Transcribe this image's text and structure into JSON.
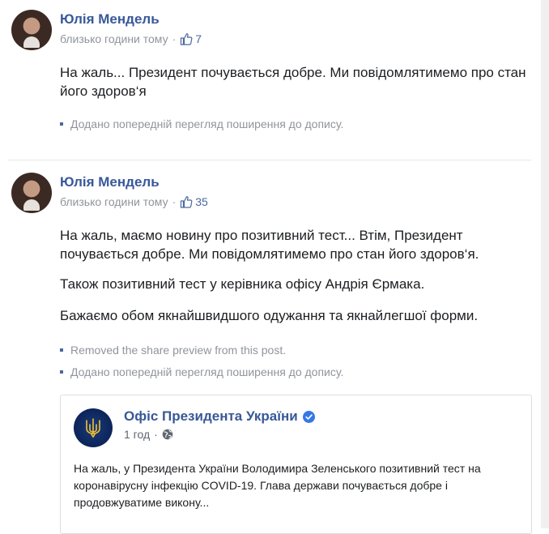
{
  "posts": [
    {
      "author": "Юлія Мендель",
      "time": "близько години тому",
      "likes": "7",
      "paragraphs": [
        "На жаль... Президент почувається добре. Ми повідомлятимемо про стан його здоров‘я"
      ],
      "log": [
        "Додано попередній перегляд поширення до допису."
      ]
    },
    {
      "author": "Юлія Мендель",
      "time": "близько години тому",
      "likes": "35",
      "paragraphs": [
        "На жаль, маємо новину про позитивний тест... Втім, Президент почувається добре. Ми повідомлятимемо про стан його здоров‘я.",
        "Також позитивний тест у керівника офісу Андрія Єрмака.",
        "Бажаємо обом якнайшвидшого одужання та якнайлегшої форми."
      ],
      "log": [
        "Removed the share preview from this post.",
        "Додано попередній перегляд поширення до допису."
      ]
    }
  ],
  "shared": {
    "page_name": "Офіс Президента України",
    "time": "1 год",
    "text": "На жаль, у Президента України Володимира Зеленського позитивний тест на коронавірусну інфекцію COVID-19. Глава держави почувається добре і продовжуватиме викону..."
  },
  "icons": {
    "like": "thumbs-up-icon",
    "globe": "globe-icon",
    "verified": "verified-badge-icon",
    "page_logo": "trident-icon"
  },
  "colors": {
    "link": "#385898",
    "meta": "#90949c",
    "verified": "#3578e5"
  }
}
